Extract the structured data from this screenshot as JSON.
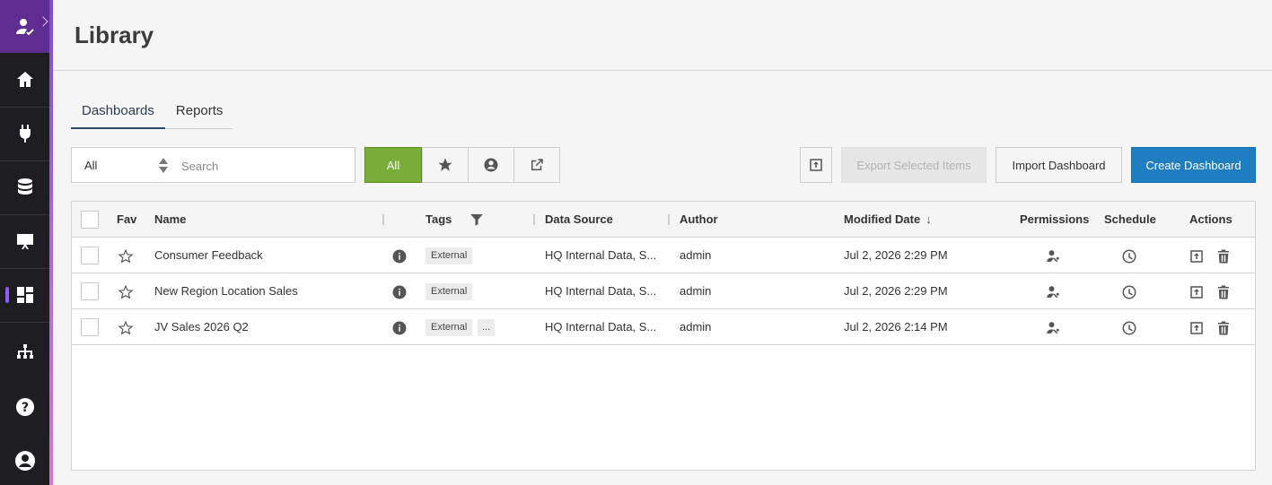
{
  "page": {
    "title": "Library"
  },
  "tabs": [
    {
      "label": "Dashboards",
      "active": true
    },
    {
      "label": "Reports",
      "active": false
    }
  ],
  "filters": {
    "select_value": "All",
    "search_placeholder": "Search",
    "all_label": "All",
    "icons": [
      "star-icon",
      "user-circle-icon",
      "external-link-icon"
    ]
  },
  "toolbar": {
    "export_selected_label": "Export Selected Items",
    "import_label": "Import Dashboard",
    "create_label": "Create Dashboard"
  },
  "table": {
    "headers": {
      "fav": "Fav",
      "name": "Name",
      "tags": "Tags",
      "data_source": "Data Source",
      "author": "Author",
      "modified": "Modified Date",
      "modified_sort": "↓",
      "permissions": "Permissions",
      "schedule": "Schedule",
      "actions": "Actions"
    },
    "rows": [
      {
        "name": "Consumer Feedback",
        "tag": "External",
        "more_tags": "",
        "data_source": "HQ Internal Data, S...",
        "author": "admin",
        "modified": "Jul 2, 2026 2:29 PM"
      },
      {
        "name": "New Region Location Sales",
        "tag": "External",
        "more_tags": "",
        "data_source": "HQ Internal Data, S...",
        "author": "admin",
        "modified": "Jul 2, 2026 2:29 PM"
      },
      {
        "name": "JV Sales 2026 Q2",
        "tag": "External",
        "more_tags": "...",
        "data_source": "HQ Internal Data, S...",
        "author": "admin",
        "modified": "Jul 2, 2026 2:14 PM"
      }
    ]
  },
  "colors": {
    "sidebar": "#1e1d22",
    "brand": "#5e2d91",
    "all_button": "#79ad3a",
    "primary_button": "#1f7dc1"
  }
}
